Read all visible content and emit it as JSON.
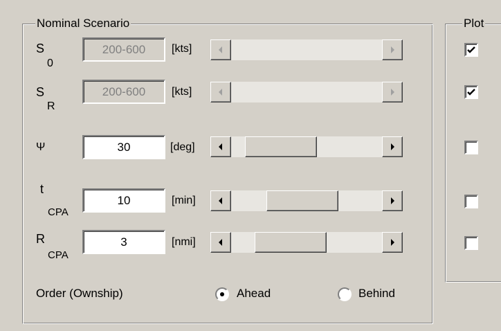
{
  "nominal": {
    "title": "Nominal Scenario",
    "rows": [
      {
        "sym": "S",
        "sub": "0",
        "value": "200-600",
        "unit": "[kts]",
        "enabled": false,
        "scroll_position": 0.0
      },
      {
        "sym": "S",
        "sub": "R",
        "value": "200-600",
        "unit": "[kts]",
        "enabled": false,
        "scroll_position": 0.0
      },
      {
        "sym": "Ψ",
        "sub": "",
        "value": "30",
        "unit": "[deg]",
        "enabled": true,
        "scroll_position": 0.02
      },
      {
        "sym": "t",
        "sub": "CPA",
        "value": "10",
        "unit": "[min]",
        "enabled": true,
        "scroll_position": 0.2
      },
      {
        "sym": "R",
        "sub": "CPA",
        "value": "3",
        "unit": "[nmi]",
        "enabled": true,
        "scroll_position": 0.14
      }
    ],
    "order_label": "Order (Ownship)",
    "ahead_label": "Ahead",
    "behind_label": "Behind",
    "ahead_selected": true
  },
  "plot": {
    "title": "Plot",
    "checks": [
      true,
      true,
      false,
      false,
      false
    ]
  },
  "icons": {
    "left_arrow": "scroll-left-arrow-icon",
    "right_arrow": "scroll-right-arrow-icon",
    "check": "checkmark-icon"
  }
}
